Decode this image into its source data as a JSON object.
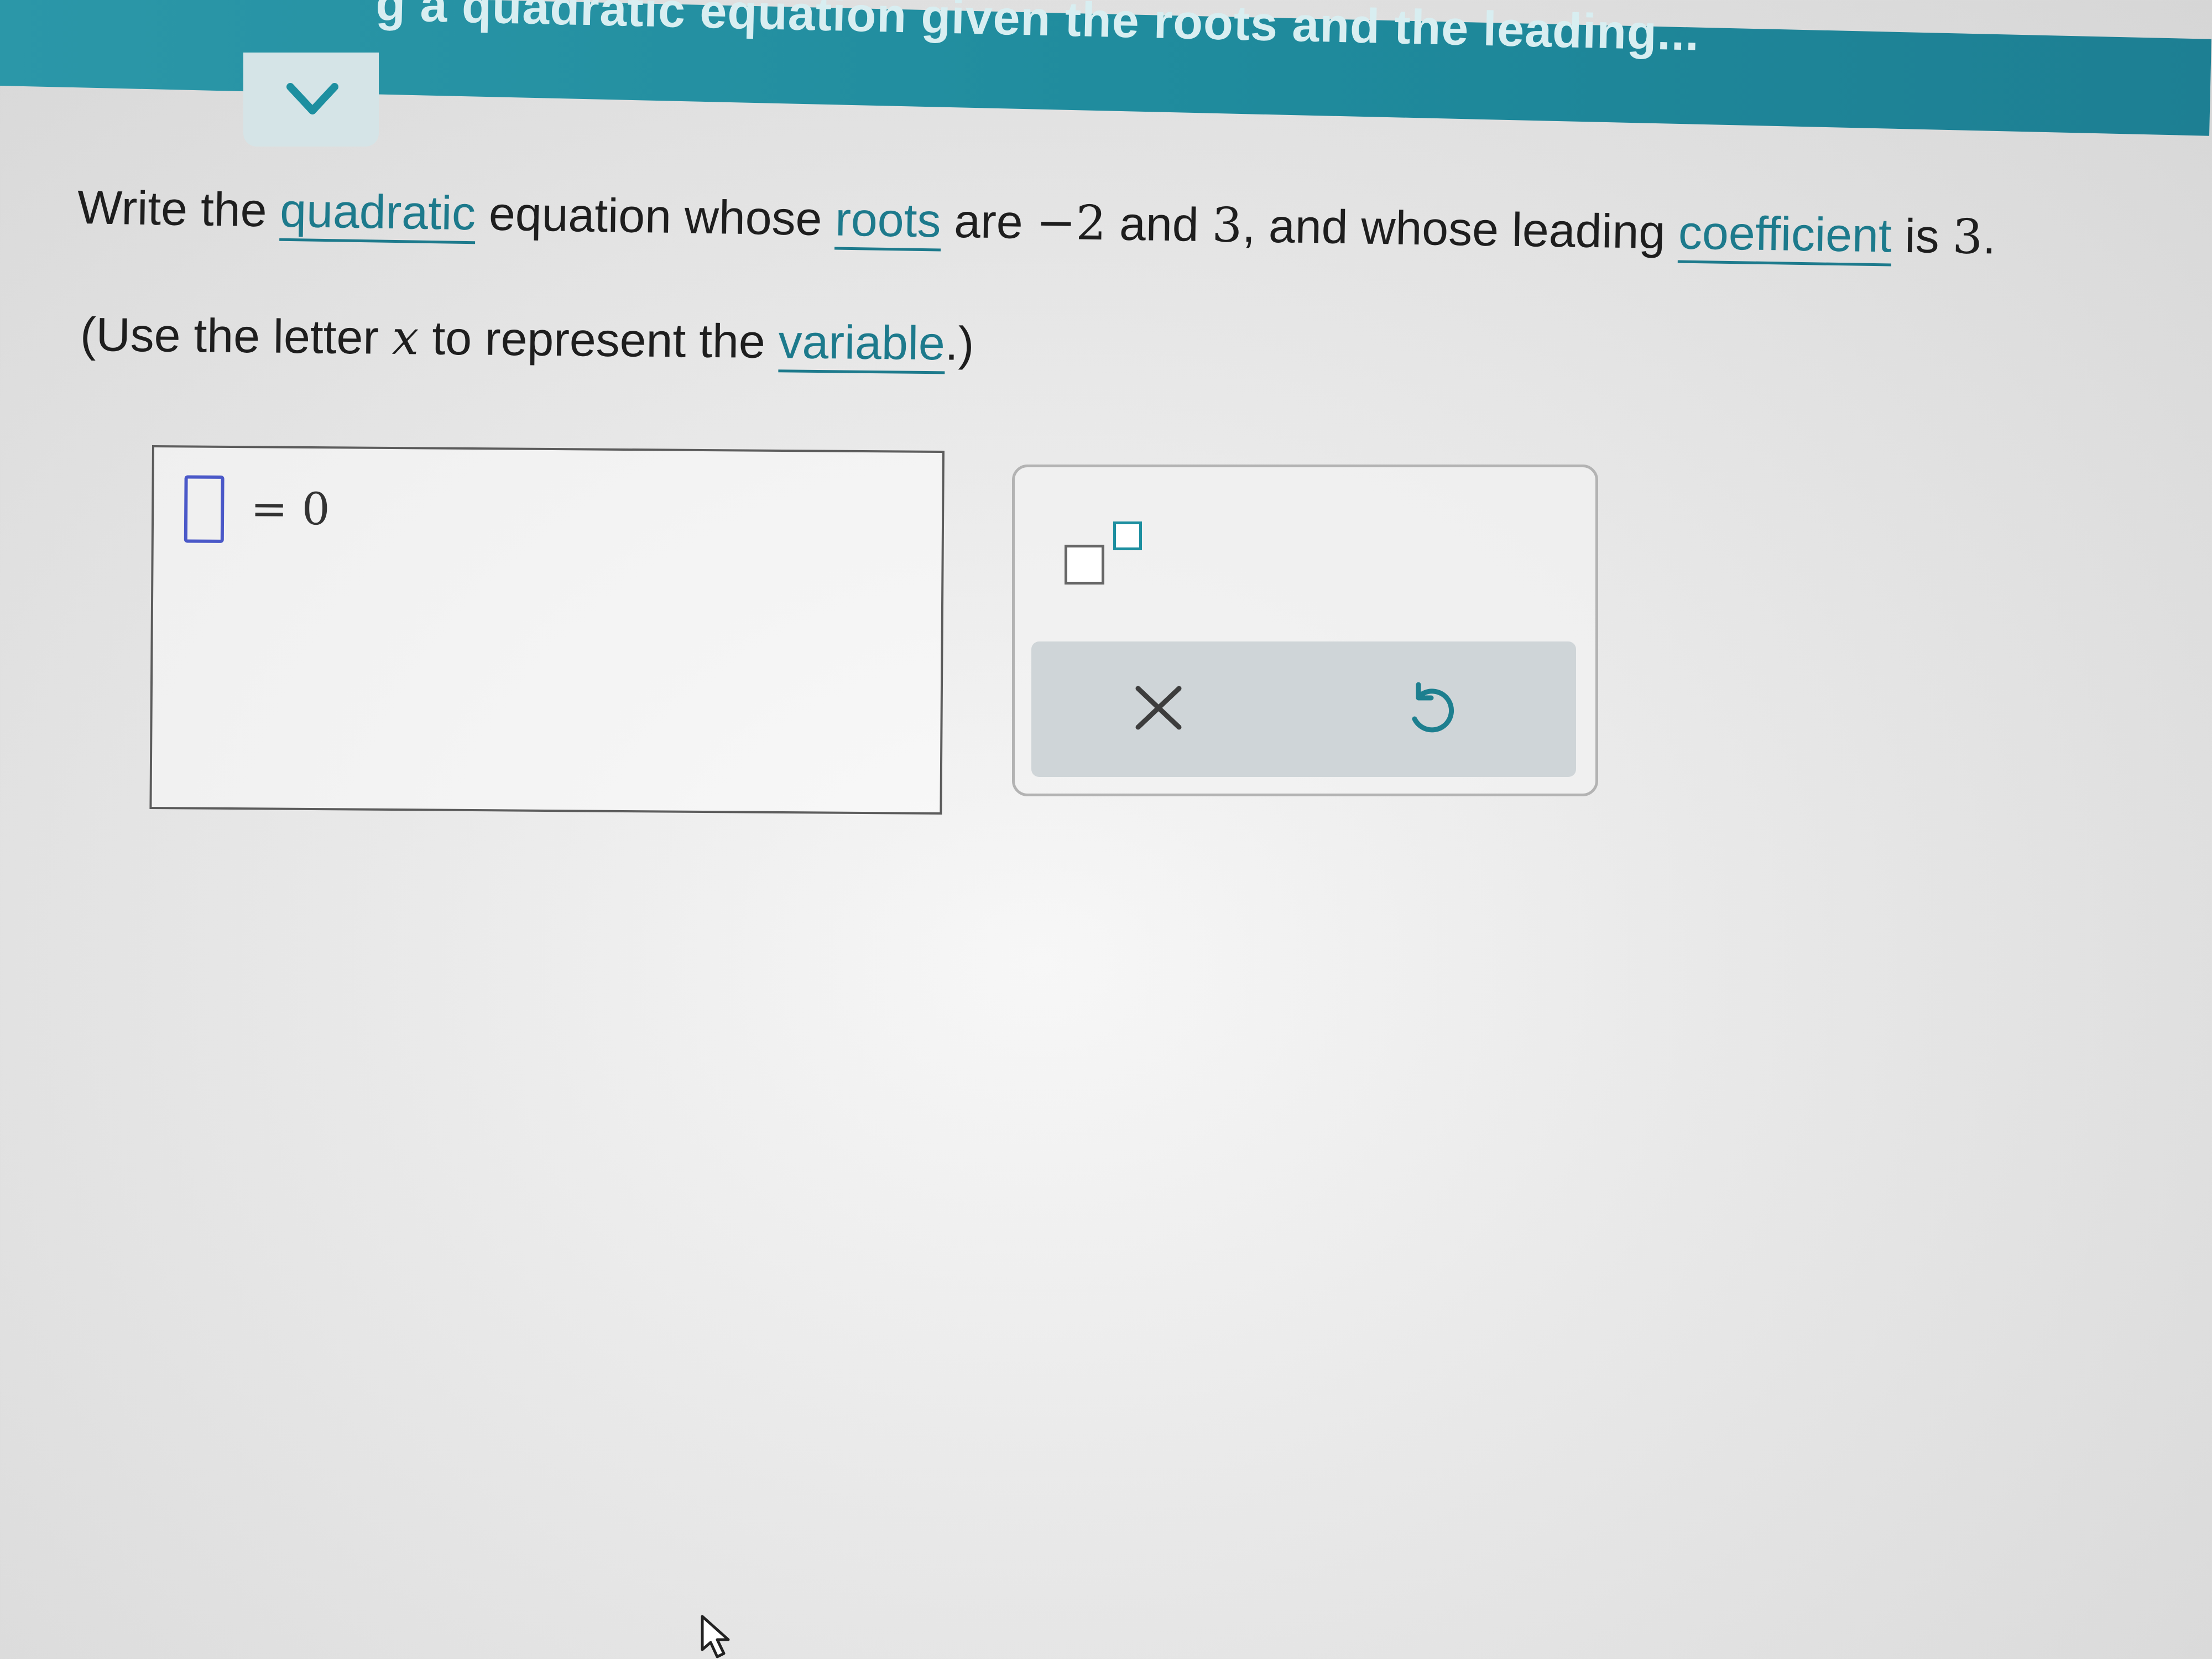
{
  "header": {
    "title": "g a quadratic equation given the roots and the leading..."
  },
  "question": {
    "part1": "Write the ",
    "link_quadratic": "quadratic",
    "part2": " equation whose ",
    "link_roots": "roots",
    "part3": " are ",
    "root1": "−2",
    "part4": " and ",
    "root2": "3",
    "part5": ", and whose leading ",
    "link_coefficient": "coefficient",
    "part6": " is ",
    "leading_coefficient": "3",
    "part7": "."
  },
  "instruction": {
    "part1": "(Use the letter ",
    "variable_letter": "x",
    "part2": " to represent the ",
    "link_variable": "variable",
    "part3": ".)"
  },
  "answer": {
    "input_value": "",
    "equals_rhs": "= 0"
  },
  "toolbar": {
    "exponent_icon": "superscript-template-icon",
    "clear_icon": "x-icon",
    "undo_icon": "undo-icon"
  },
  "colors": {
    "accent": "#1d7a8c",
    "header": "#2396a8",
    "slot": "#4a58c8"
  }
}
